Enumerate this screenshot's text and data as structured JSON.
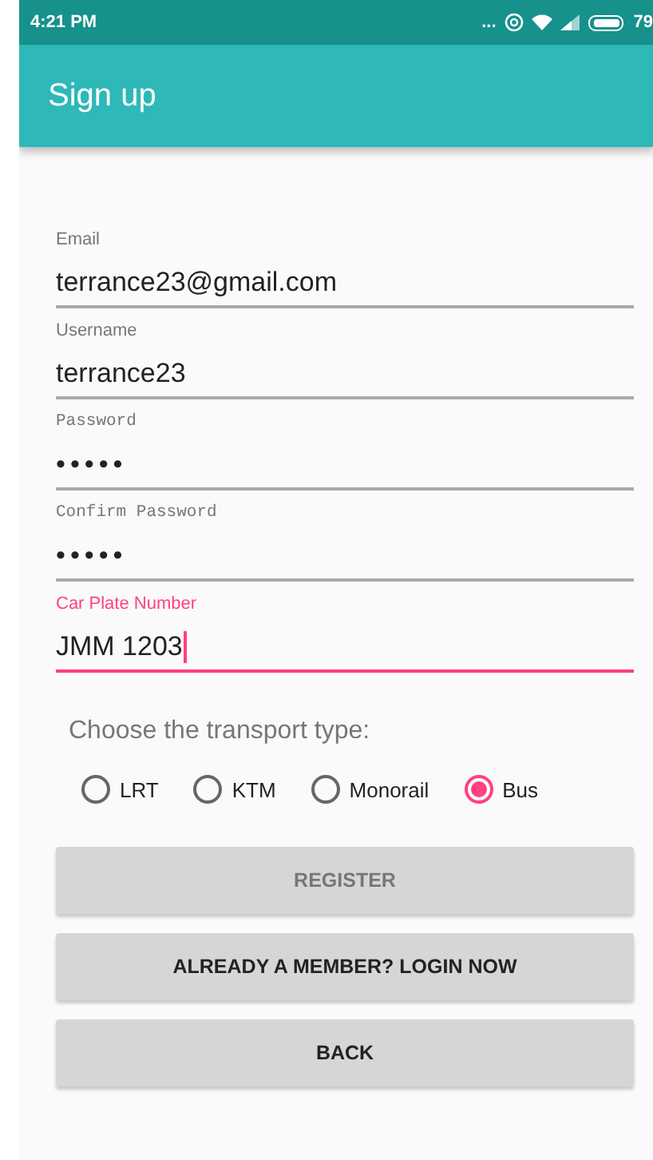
{
  "status_bar": {
    "time": "4:21 PM",
    "dots": "...",
    "battery": "79"
  },
  "app_bar": {
    "title": "Sign up"
  },
  "fields": [
    {
      "label": "Email",
      "value": "terrance23@gmail.com",
      "kind": "text",
      "focused": false
    },
    {
      "label": "Username",
      "value": "terrance23",
      "kind": "text",
      "focused": false
    },
    {
      "label": "Password",
      "value": "•••••",
      "kind": "password",
      "focused": false
    },
    {
      "label": "Confirm Password",
      "value": "•••••",
      "kind": "password",
      "focused": false
    },
    {
      "label": "Car Plate Number",
      "value": "JMM 1203",
      "kind": "text",
      "focused": true
    }
  ],
  "transport": {
    "prompt": "Choose the transport type:",
    "options": [
      {
        "label": "LRT",
        "selected": false
      },
      {
        "label": "KTM",
        "selected": false
      },
      {
        "label": "Monorail",
        "selected": false
      },
      {
        "label": "Bus",
        "selected": true
      }
    ]
  },
  "buttons": [
    {
      "label": "REGISTER",
      "disabled": true
    },
    {
      "label": "ALREADY A MEMBER? LOGIN NOW",
      "disabled": false
    },
    {
      "label": "BACK",
      "disabled": false
    }
  ]
}
